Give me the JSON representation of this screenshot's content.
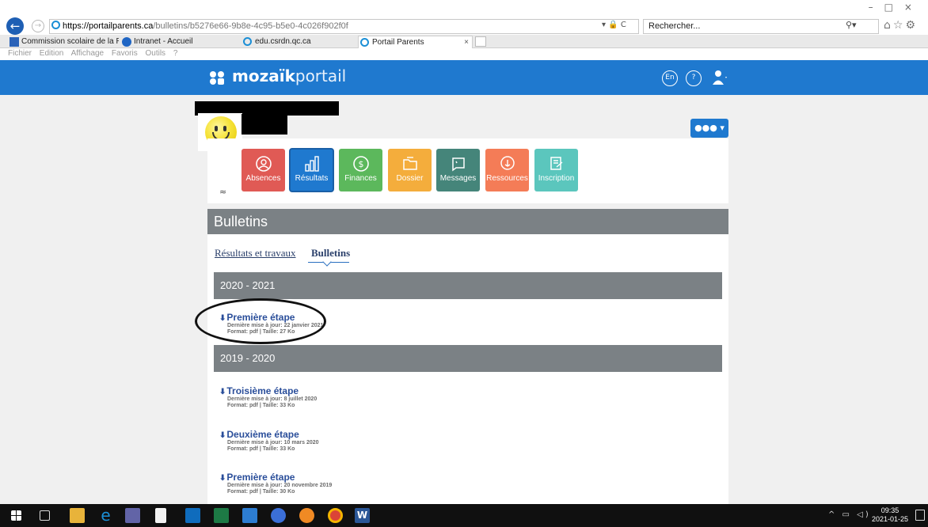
{
  "browser": {
    "url_domain": "https://portailparents.ca",
    "url_path": "/bulletins/b5276e66-9b8e-4c95-b5e0-4c026f902f0f",
    "search_placeholder": "Rechercher...",
    "tabs": [
      {
        "label": "Commission scolaire de la Rivi...",
        "active": false
      },
      {
        "label": "Intranet - Accueil",
        "active": false
      },
      {
        "label": "edu.csrdn.qc.ca",
        "active": false
      },
      {
        "label": "Portail Parents",
        "active": true
      }
    ],
    "menu": [
      "Fichier",
      "Edition",
      "Affichage",
      "Favoris",
      "Outils",
      "?"
    ]
  },
  "header": {
    "logo_bold": "mozaïk",
    "logo_light": "portail",
    "lang_label": "En",
    "help_label": "?"
  },
  "tiles": [
    {
      "label": "Absences",
      "color": "#e05a55",
      "icon": "absence-icon"
    },
    {
      "label": "Résultats",
      "color": "#1f79cf",
      "icon": "results-chart-icon",
      "active": true
    },
    {
      "label": "Finances",
      "color": "#5cb85c",
      "icon": "dollar-icon"
    },
    {
      "label": "Dossier",
      "color": "#f4ad3c",
      "icon": "folder-icon"
    },
    {
      "label": "Messages",
      "color": "#45857a",
      "icon": "messages-icon"
    },
    {
      "label": "Ressources",
      "color": "#f47c57",
      "icon": "resources-icon"
    },
    {
      "label": "Inscription",
      "color": "#5bc6bd",
      "icon": "inscription-icon"
    }
  ],
  "section": {
    "title": "Bulletins",
    "subtab_link": "Résultats et travaux",
    "subtab_current": "Bulletins"
  },
  "years": [
    {
      "label": "2020 - 2021",
      "docs": [
        {
          "title": "Première étape",
          "updated": "Dernière mise à jour: 22 janvier 2021",
          "format": "Format: pdf | Taille: 27 Ko"
        }
      ]
    },
    {
      "label": "2019 - 2020",
      "docs": [
        {
          "title": "Troisième étape",
          "updated": "Dernière mise à jour: 8 juillet 2020",
          "format": "Format: pdf | Taille: 33 Ko"
        },
        {
          "title": "Deuxième étape",
          "updated": "Dernière mise à jour: 10 mars 2020",
          "format": "Format: pdf | Taille: 33 Ko"
        },
        {
          "title": "Première étape",
          "updated": "Dernière mise à jour: 20 novembre 2019",
          "format": "Format: pdf | Taille: 30 Ko"
        }
      ]
    }
  ],
  "taskbar": {
    "time": "09:35",
    "date": "2021-01-25"
  }
}
